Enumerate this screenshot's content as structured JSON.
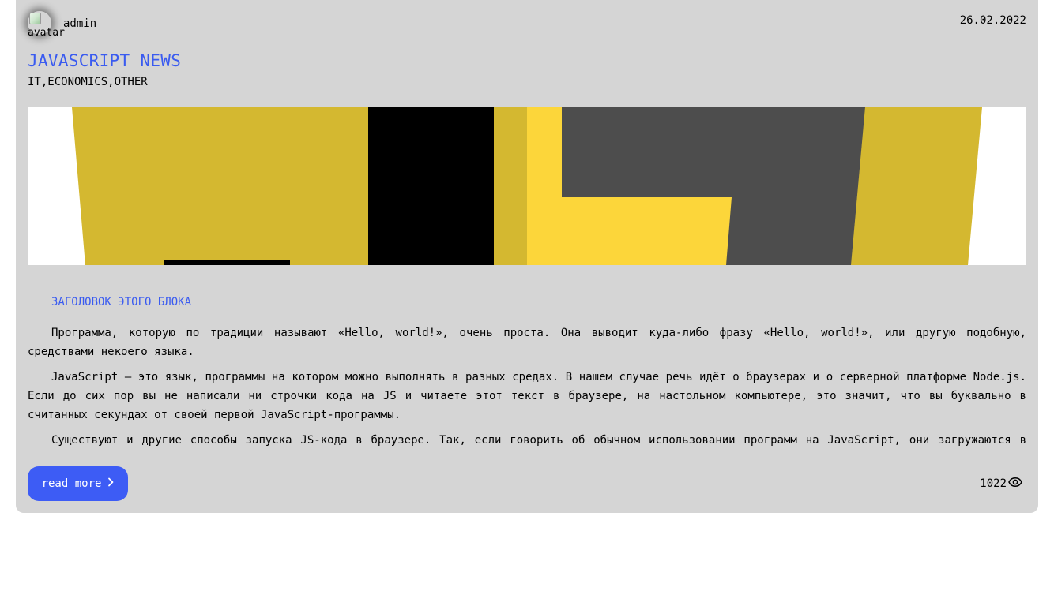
{
  "post": {
    "author": {
      "name": "admin",
      "avatar_alt": "avatar"
    },
    "date": "26.02.2022",
    "title": "JAVASCRIPT NEWS",
    "tags": "IT,ECONOMICS,OTHER",
    "cover_image": "javascript-logo-crop",
    "block_heading": "ЗАГОЛОВОК ЭТОГО БЛОКА",
    "paragraphs": [
      "Программа, которую по традиции называют «Hello, world!», очень проста. Она выводит куда-либо фразу «Hello, world!», или другую подобную, средствами некоего языка.",
      "JavaScript — это язык, программы на котором можно выполнять в разных средах. В нашем случае речь идёт о браузерах и о серверной платформе Node.js. Если до сих пор вы не написали ни строчки кода на JS и читаете этот текст в браузере, на настольном компьютере, это значит, что вы буквально в считанных секундах от своей первой JavaScript-программы.",
      "Существуют и другие способы запуска JS-кода в браузере. Так, если говорить об обычном использовании программ на JavaScript, они загружаются в браузер для обеспечения работы веб-страниц."
    ],
    "read_more_label": "read more",
    "views": "1022"
  },
  "icons": {
    "read_more": "chevron-right-icon",
    "views": "eye-icon"
  },
  "colors": {
    "accent": "#3d5cf5",
    "title": "#3a5bf0",
    "card_bg": "#d5d5d5",
    "logo_yellow_dark": "#d4b830",
    "logo_yellow": "#fcd63a",
    "logo_gray": "#4d4d4d"
  }
}
